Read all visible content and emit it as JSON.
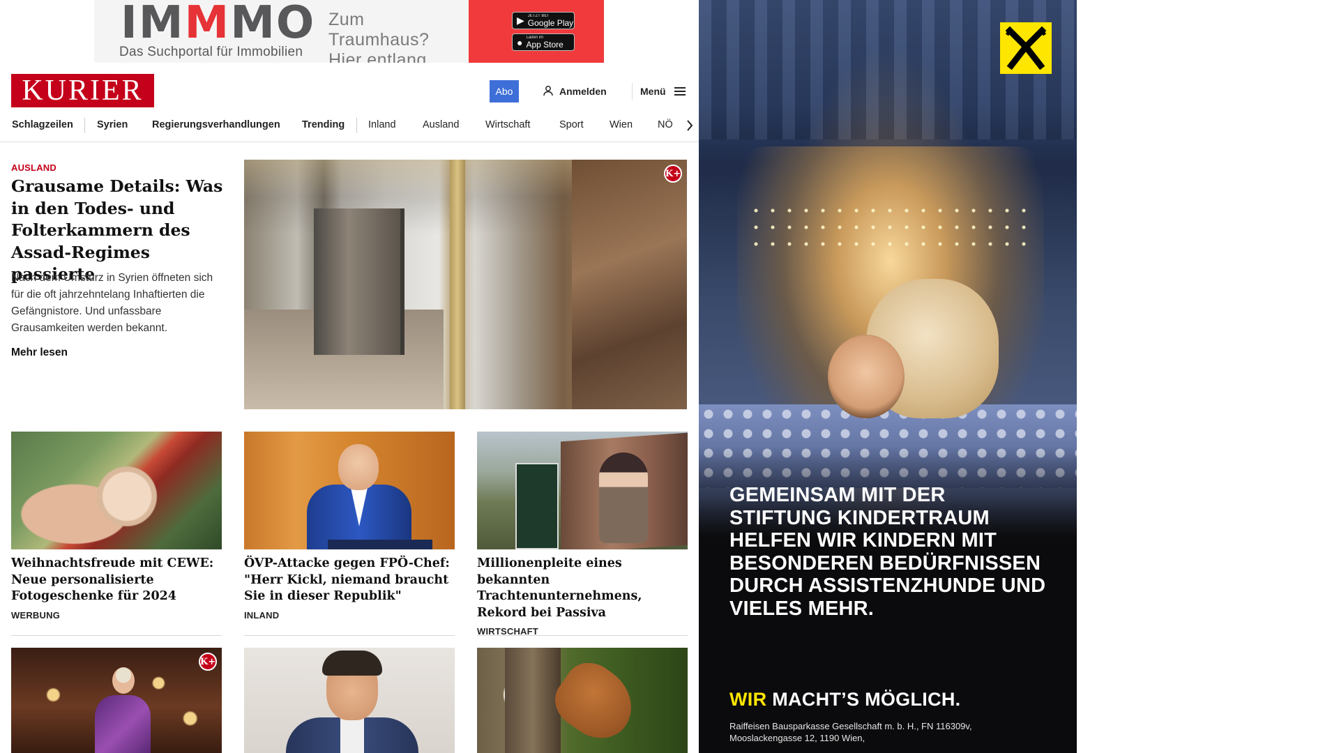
{
  "top_banner": {
    "logo_part1": "IM",
    "logo_part2": "M",
    "logo_part3": "MO",
    "tagline": "Das Suchportal für Immobilien",
    "cta_line1": "Zum Traumhaus?",
    "cta_line2": "Hier entlang.",
    "google_play_small": "JETZT BEI",
    "google_play_label": "Google Play",
    "app_store_small": "Laden im",
    "app_store_label": "App Store",
    "accent_color": "#f03a3c"
  },
  "header": {
    "logo_text": "KURIER",
    "abo_label": "Abo",
    "login_label": "Anmelden",
    "menu_label": "Menü",
    "brand_color": "#c4001a"
  },
  "nav": {
    "items": [
      {
        "label": "Schlagzeilen"
      },
      {
        "label": "Syrien"
      },
      {
        "label": "Regierungsverhandlungen"
      },
      {
        "label": "Trending"
      },
      {
        "label": "Inland"
      },
      {
        "label": "Ausland"
      },
      {
        "label": "Wirtschaft"
      },
      {
        "label": "Sport"
      },
      {
        "label": "Wien"
      },
      {
        "label": "NÖ"
      }
    ]
  },
  "hero": {
    "kicker": "AUSLAND",
    "title": "Grausame Details: Was in den Todes- und Folter­kammern des Assad-Re­gimes passierte",
    "teaser": "Nach dem Umsturz in Syrien öffneten sich für die oft jahrzehntelang Inhaftierten die Gefängnistore. Und unfassbare Grausamkeiten werden bekannt.",
    "more_label": "Mehr lesen",
    "premium_badge": "K+"
  },
  "cards": [
    {
      "title": "Weihnachtsfreude mit CEWE: Neue personalisierte Fotogeschenke für 2024",
      "section": "WERBUNG"
    },
    {
      "title": "ÖVP-Attacke gegen FPÖ-Chef: \"Herr Kickl, niemand braucht Sie in dieser Republik\"",
      "section": "INLAND"
    },
    {
      "title": "Millionenpleite eines bekannten Trachtenunternehmens, Rekord bei Passiva",
      "section": "WIRTSCHAFT"
    },
    {
      "premium_badge": "K+"
    }
  ],
  "side_ad": {
    "headline": "Gemeinsam mit der Stiftung Kindertraum helfen wir Kindern mit besonderen Bedürfnissen durch Assistenzhunde und vieles mehr.",
    "slogan_highlight": "WIR",
    "slogan_rest": " MACHT’S MÖGLICH.",
    "legal_line1": "Raiffeisen Bausparkasse Gesellschaft m. b. H., FN 116309v,",
    "legal_line2": "Mooslackengasse 12, 1190 Wien,",
    "highlight_color": "#ffe600"
  }
}
